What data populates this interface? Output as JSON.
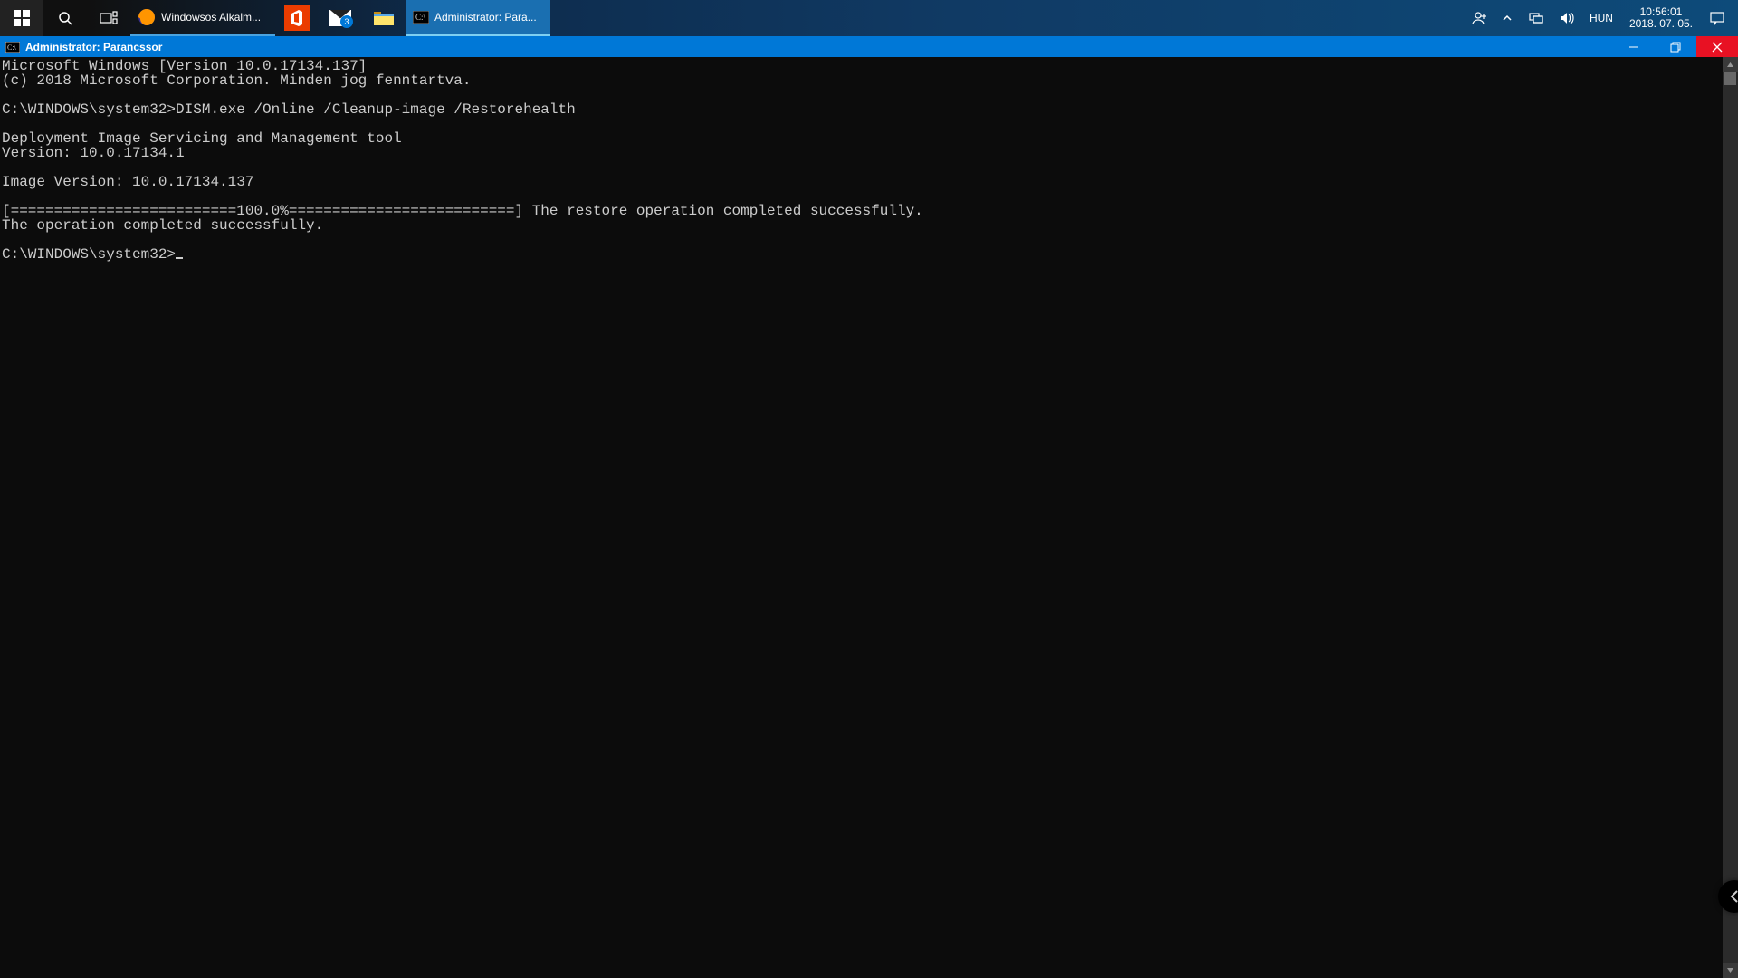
{
  "taskbar": {
    "apps": [
      {
        "name": "firefox",
        "label": "Windowsos Alkalm..."
      },
      {
        "name": "cmd",
        "label": "Administrator: Para..."
      }
    ],
    "mail_badge": "3",
    "ime": "HUN",
    "clock_time": "10:56:01",
    "clock_date": "2018. 07. 05."
  },
  "window": {
    "title": "Administrator: Parancssor"
  },
  "terminal": {
    "lines": [
      "Microsoft Windows [Version 10.0.17134.137]",
      "(c) 2018 Microsoft Corporation. Minden jog fenntartva.",
      "",
      "C:\\WINDOWS\\system32>DISM.exe /Online /Cleanup-image /Restorehealth",
      "",
      "Deployment Image Servicing and Management tool",
      "Version: 10.0.17134.1",
      "",
      "Image Version: 10.0.17134.137",
      "",
      "[==========================100.0%==========================] The restore operation completed successfully.",
      "The operation completed successfully.",
      ""
    ],
    "prompt": "C:\\WINDOWS\\system32>"
  }
}
